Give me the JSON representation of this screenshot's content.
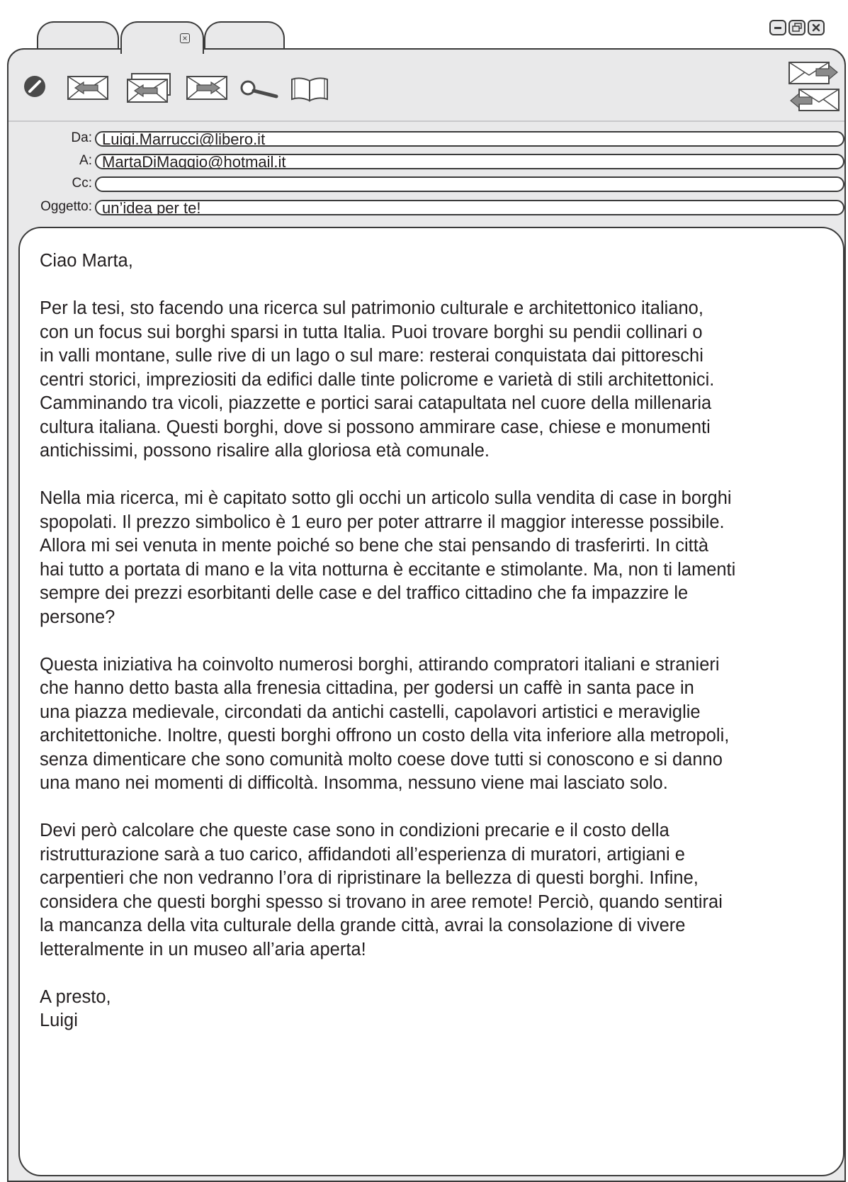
{
  "window": {
    "tabs": [
      {
        "label": ""
      },
      {
        "label": "",
        "active": true
      },
      {
        "label": ""
      }
    ],
    "controls": [
      "minimize-icon",
      "restore-icon",
      "close-icon"
    ]
  },
  "toolbar": {
    "icons": [
      "no-entry-icon",
      "reply-icon",
      "reply-all-icon",
      "forward-icon",
      "search-icon",
      "address-book-icon",
      "send-receive-icon"
    ]
  },
  "header": {
    "from_label": "Da:",
    "from_value": "Luigi.Marrucci@libero.it",
    "to_label": "A:",
    "to_value": "MartaDiMaggio@hotmail.it",
    "cc_label": "Cc:",
    "cc_value": "",
    "subject_label": "Oggetto:",
    "subject_value": "un’idea per te!"
  },
  "message": {
    "greeting": "Ciao Marta,",
    "p1": "Per la tesi, sto facendo una ricerca sul patrimonio culturale e architettonico italiano,\ncon un focus sui borghi sparsi in tutta Italia. Puoi trovare borghi su pendii collinari o\nin valli montane, sulle rive di un lago o sul mare: resterai conquistata dai pittoreschi\ncentri storici, impreziositi da edifici dalle tinte policrome e varietà di stili architettonici.\nCamminando tra vicoli, piazzette e portici sarai catapultata nel cuore della millenaria\ncultura italiana. Questi borghi, dove si possono ammirare case, chiese e monumenti\nantichissimi, possono risalire alla gloriosa età comunale.",
    "p2": "Nella mia ricerca, mi è capitato sotto gli occhi un articolo sulla vendita di case in borghi\nspopolati. Il prezzo simbolico è 1 euro per poter attrarre il maggior interesse possibile.\nAllora mi sei venuta in mente poiché so bene che stai pensando di trasferirti. In città\nhai tutto a portata di mano e la vita notturna è eccitante e stimolante. Ma, non ti lamenti\nsempre dei prezzi esorbitanti delle case e del traffico cittadino che fa impazzire le\npersone?",
    "p3": "Questa iniziativa ha coinvolto numerosi borghi, attirando compratori italiani e stranieri\nche hanno detto basta alla frenesia cittadina, per godersi un caffè in santa pace in\nuna piazza medievale, circondati da antichi castelli, capolavori artistici e meraviglie\narchitettoniche. Inoltre, questi borghi offrono un costo della vita inferiore alla metropoli,\nsenza dimenticare che sono comunità molto coese dove tutti si conoscono e si danno\nuna mano nei momenti di difficoltà. Insomma, nessuno viene mai lasciato solo.",
    "p4": "Devi però calcolare che queste case sono in condizioni precarie e il costo della\nristrutturazione sarà a tuo carico, affidandoti all’esperienza di muratori, artigiani e\ncarpentieri che non vedranno l’ora di ripristinare la bellezza di questi borghi. Infine,\nconsidera che questi borghi spesso si trovano in aree remote! Perciò, quando sentirai\nla mancanza della vita culturale della grande città, avrai la consolazione di vivere\nletteralmente in un museo all’aria aperta!",
    "closing": "A presto,\nLuigi"
  }
}
